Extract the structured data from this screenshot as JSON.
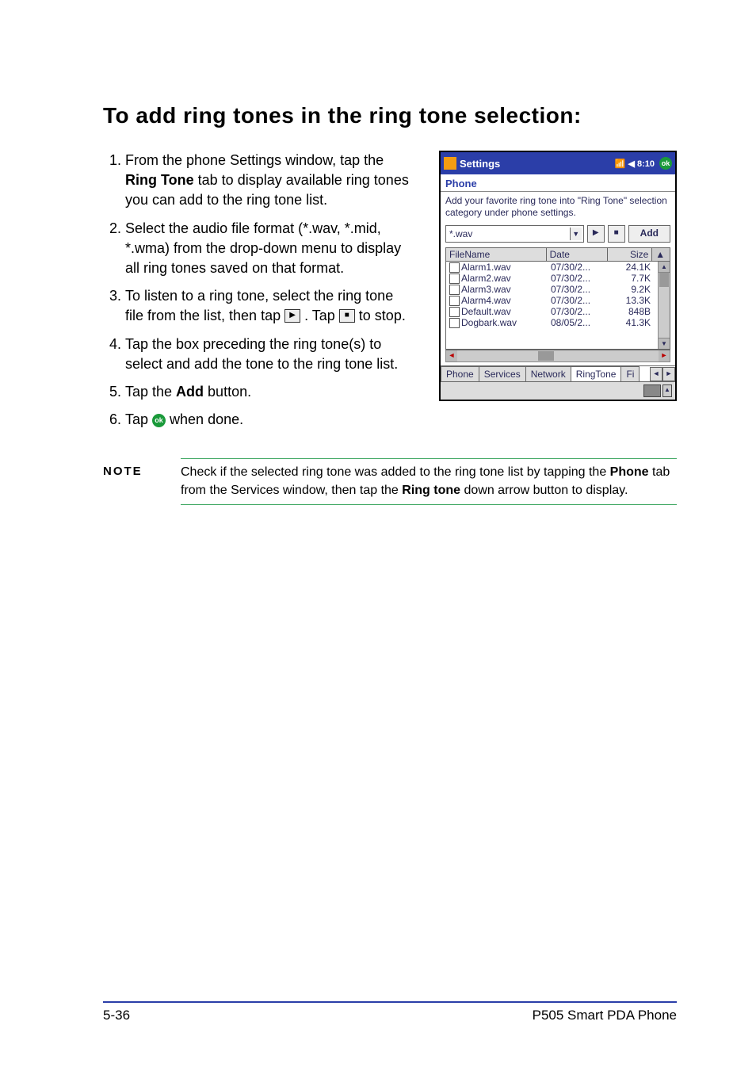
{
  "title": "To add ring tones in the ring tone selection:",
  "steps": {
    "s1a": "From the phone Settings window, tap the ",
    "s1_bold": "Ring Tone",
    "s1b": " tab to display available ring tones you can add to the ring tone list.",
    "s2": "Select the audio file format (*.wav, *.mid, *.wma) from the drop-down menu to display all ring tones saved on that format.",
    "s3a": "To listen to a ring tone, select the ring tone file from the list, then tap ",
    "s3b": " . Tap ",
    "s3c": " to stop.",
    "s4": "Tap the box preceding the ring tone(s) to select and add the tone to the ring tone list.",
    "s5a": "Tap the ",
    "s5_bold": "Add",
    "s5b": " button.",
    "s6a": "Tap ",
    "s6b": " when done."
  },
  "icons": {
    "play": "▶",
    "stop": "■",
    "ok": "ok"
  },
  "shot": {
    "title": "Settings",
    "status": "📶 ◀ 8:10",
    "ok": "ok",
    "section": "Phone",
    "desc": "Add your favorite ring tone into \"Ring Tone\" selection category under phone settings.",
    "format": "*.wav",
    "add": "Add",
    "headers": {
      "name": "FileName",
      "date": "Date",
      "size": "Size"
    },
    "rows": [
      {
        "name": "Alarm1.wav",
        "date": "07/30/2...",
        "size": "24.1K"
      },
      {
        "name": "Alarm2.wav",
        "date": "07/30/2...",
        "size": "7.7K"
      },
      {
        "name": "Alarm3.wav",
        "date": "07/30/2...",
        "size": "9.2K"
      },
      {
        "name": "Alarm4.wav",
        "date": "07/30/2...",
        "size": "13.3K"
      },
      {
        "name": "Default.wav",
        "date": "07/30/2...",
        "size": "848B"
      },
      {
        "name": "Dogbark.wav",
        "date": "08/05/2...",
        "size": "41.3K"
      }
    ],
    "tabs": [
      "Phone",
      "Services",
      "Network",
      "RingTone",
      "Fi"
    ]
  },
  "note": {
    "label": "NOTE",
    "a": "Check if the selected ring tone was added to the ring tone list by tapping the ",
    "bold1": "Phone",
    "b": " tab from the Services window, then tap the ",
    "bold2": "Ring tone",
    "c": " down arrow button to display."
  },
  "footer": {
    "left": "5-36",
    "right": "P505 Smart PDA Phone"
  }
}
